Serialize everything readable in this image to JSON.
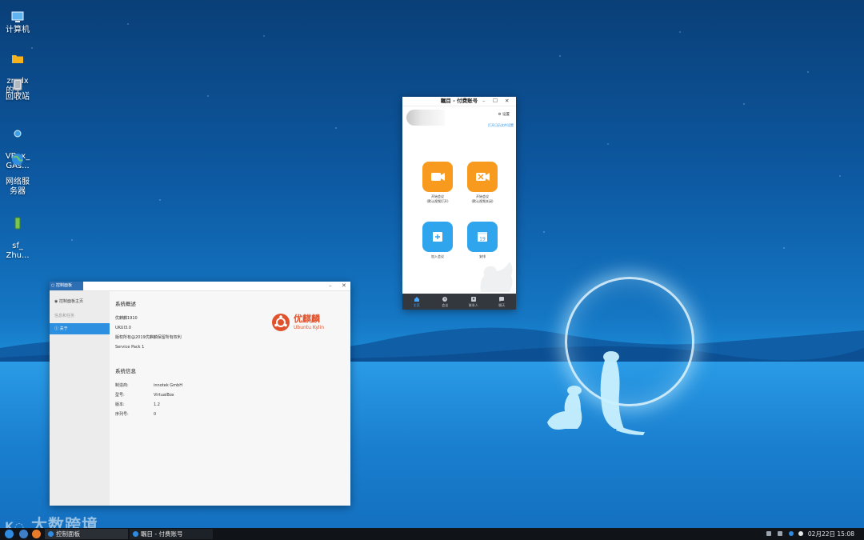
{
  "desktop_icons": [
    {
      "name": "computer",
      "label": "计算机"
    },
    {
      "name": "folder",
      "label": "zmdx\n的主..."
    },
    {
      "name": "trash",
      "label": "回收站"
    },
    {
      "name": "vbox",
      "label": "VBox_\nGAs..."
    },
    {
      "name": "network",
      "label": "网络服\n务器"
    },
    {
      "name": "shared",
      "label": "sf_\nZhu..."
    }
  ],
  "control_panel": {
    "title": "控制面板",
    "sidebar": {
      "home": "控制面板主页",
      "section": "信息和任务",
      "about": "关于"
    },
    "overview": {
      "heading": "系统概述",
      "lines": [
        "优麒麟1910",
        "UKUI3.0",
        "版权所有@2019优麒麟保留所有权利",
        "Service Pack 1"
      ]
    },
    "sysinfo": {
      "heading": "系统信息",
      "rows": [
        {
          "key": "制造商:",
          "value": "innotek GmbH"
        },
        {
          "key": "型号:",
          "value": "VirtualBox"
        },
        {
          "key": "版本:",
          "value": "1.2"
        },
        {
          "key": "序列号:",
          "value": "0"
        }
      ]
    },
    "logo": {
      "cn": "优麒麟",
      "en": "Ubuntu Kylin"
    }
  },
  "meeting": {
    "title": "瞩目 - 付费账号",
    "settings": "设置",
    "tip": "打开日历文件设置",
    "tiles": [
      {
        "label": "开始会议\n(默认视频打开)",
        "color": "#f79a1d",
        "icon": "video-icon"
      },
      {
        "label": "开始会议\n(默认视频关闭)",
        "color": "#f79a1d",
        "icon": "video-off-icon"
      },
      {
        "label": "加入会议",
        "color": "#2ea5ec",
        "icon": "join-icon"
      },
      {
        "label": "安排",
        "color": "#2ea5ec",
        "icon": "calendar-icon"
      }
    ],
    "calendar_day": "19",
    "nav": [
      "主页",
      "会议",
      "联系人",
      "聊天"
    ]
  },
  "taskbar": {
    "items": [
      "控制面板",
      "瞩目 - 付费账号"
    ],
    "clock": "02月22日 15:08"
  },
  "watermark": "大数跨境"
}
